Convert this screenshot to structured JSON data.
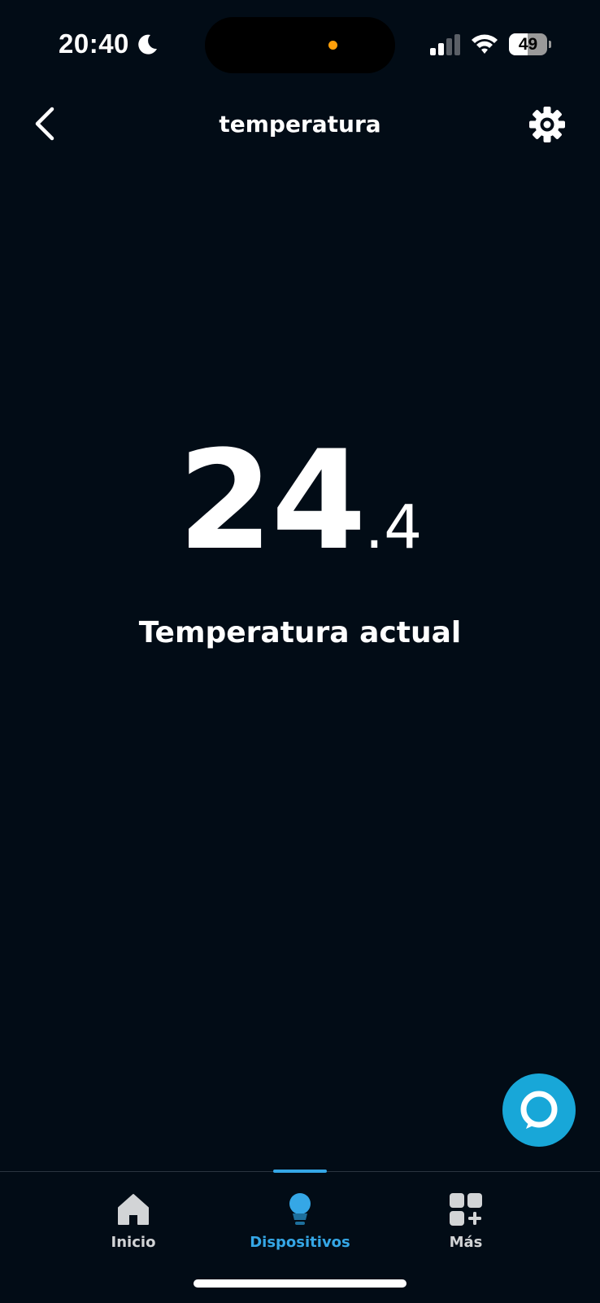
{
  "status_bar": {
    "time": "20:40",
    "battery_level": "49",
    "battery_fraction": 0.49
  },
  "header": {
    "title": "temperatura"
  },
  "temperature": {
    "integer": "24",
    "decimal": ".4",
    "caption": "Temperatura actual"
  },
  "nav": {
    "items": [
      {
        "label": "Inicio",
        "icon": "home-icon",
        "active": false
      },
      {
        "label": "Dispositivos",
        "icon": "lightbulb-icon",
        "active": true
      },
      {
        "label": "Más",
        "icon": "more-grid-icon",
        "active": false
      }
    ]
  },
  "colors": {
    "background": "#020c16",
    "accent": "#35a7e6",
    "alexa": "#18a7d8",
    "recording_dot": "#ff9f0a"
  },
  "icons": {
    "back": "chevron-left-icon",
    "settings": "gear-icon",
    "assistant": "alexa-icon"
  }
}
